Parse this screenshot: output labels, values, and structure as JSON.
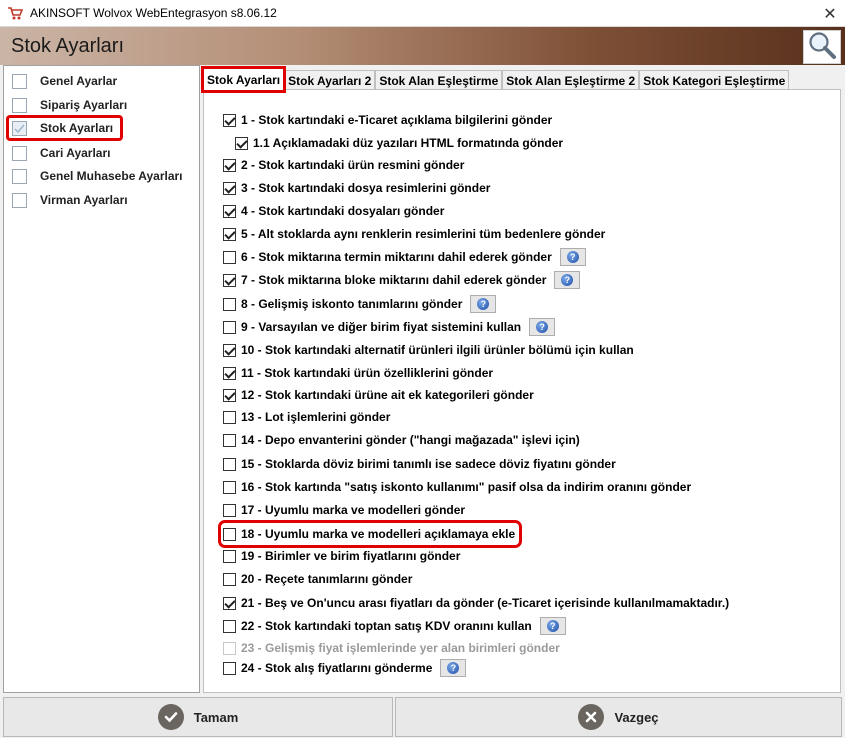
{
  "window": {
    "title": "AKINSOFT Wolvox WebEntegrasyon s8.06.12",
    "close_glyph": "✕"
  },
  "header": {
    "title": "Stok Ayarları"
  },
  "sidebar": {
    "items": [
      {
        "label": "Genel Ayarlar"
      },
      {
        "label": "Sipariş Ayarları"
      },
      {
        "label": "Stok Ayarları"
      },
      {
        "label": "Cari Ayarları"
      },
      {
        "label": "Genel Muhasebe Ayarları"
      },
      {
        "label": "Virman Ayarları"
      }
    ]
  },
  "tabs": [
    {
      "label": "Stok Ayarları"
    },
    {
      "label": "Stok Ayarları 2"
    },
    {
      "label": "Stok Alan Eşleştirme"
    },
    {
      "label": "Stok Alan Eşleştirme 2"
    },
    {
      "label": "Stok Kategori Eşleştirme"
    }
  ],
  "options": [
    {
      "label": "1 - Stok kartındaki e-Ticaret açıklama bilgilerini gönder",
      "checked": true
    },
    {
      "label": "1.1 Açıklamadaki düz yazıları HTML formatında gönder",
      "checked": true
    },
    {
      "label": "2 - Stok kartındaki ürün resmini gönder",
      "checked": true
    },
    {
      "label": "3 - Stok kartındaki dosya resimlerini gönder",
      "checked": true
    },
    {
      "label": "4 - Stok kartındaki dosyaları gönder",
      "checked": true
    },
    {
      "label": "5 - Alt stoklarda aynı renklerin resimlerini tüm bedenlere gönder",
      "checked": true
    },
    {
      "label": "6 - Stok miktarına termin miktarını dahil ederek gönder",
      "checked": false
    },
    {
      "label": "7 - Stok miktarına bloke miktarını dahil ederek gönder",
      "checked": true
    },
    {
      "label": "8 - Gelişmiş iskonto tanımlarını gönder",
      "checked": false
    },
    {
      "label": "9 - Varsayılan ve diğer birim fiyat sistemini kullan",
      "checked": false
    },
    {
      "label": "10 - Stok kartındaki alternatif ürünleri ilgili ürünler bölümü için kullan",
      "checked": true
    },
    {
      "label": "11 - Stok kartındaki ürün özelliklerini gönder",
      "checked": true
    },
    {
      "label": "12 - Stok kartındaki ürüne ait ek kategorileri gönder",
      "checked": true
    },
    {
      "label": "13 - Lot işlemlerini gönder",
      "checked": false
    },
    {
      "label": "14 - Depo envanterini gönder (\"hangi mağazada\" işlevi için)",
      "checked": false
    },
    {
      "label": "15 - Stoklarda döviz birimi tanımlı ise sadece döviz fiyatını gönder",
      "checked": false
    },
    {
      "label": "16 - Stok kartında \"satış iskonto kullanımı\" pasif olsa da indirim oranını gönder",
      "checked": false
    },
    {
      "label": "17 - Uyumlu marka ve modelleri gönder",
      "checked": false
    },
    {
      "label": "18 - Uyumlu marka ve modelleri açıklamaya ekle",
      "checked": false
    },
    {
      "label": "19 - Birimler ve birim fiyatlarını gönder",
      "checked": false
    },
    {
      "label": "20 - Reçete tanımlarını gönder",
      "checked": false
    },
    {
      "label": "21 - Beş ve On'uncu arası fiyatları da gönder (e-Ticaret içerisinde kullanılmamaktadır.)",
      "checked": true
    },
    {
      "label": "22 - Stok kartındaki toptan satış KDV oranını kullan",
      "checked": false
    },
    {
      "label": "23 - Gelişmiş fiyat işlemlerinde yer alan birimleri gönder",
      "checked": false,
      "disabled": true
    },
    {
      "label": "24 - Stok alış fiyatlarını gönderme",
      "checked": false
    }
  ],
  "help_glyph": "?",
  "footer": {
    "ok_label": "Tamam",
    "cancel_label": "Vazgeç"
  },
  "colors": {
    "highlight": "#e00000",
    "header_gradient_end": "#57301c",
    "help_icon": "#1e4fa8"
  }
}
